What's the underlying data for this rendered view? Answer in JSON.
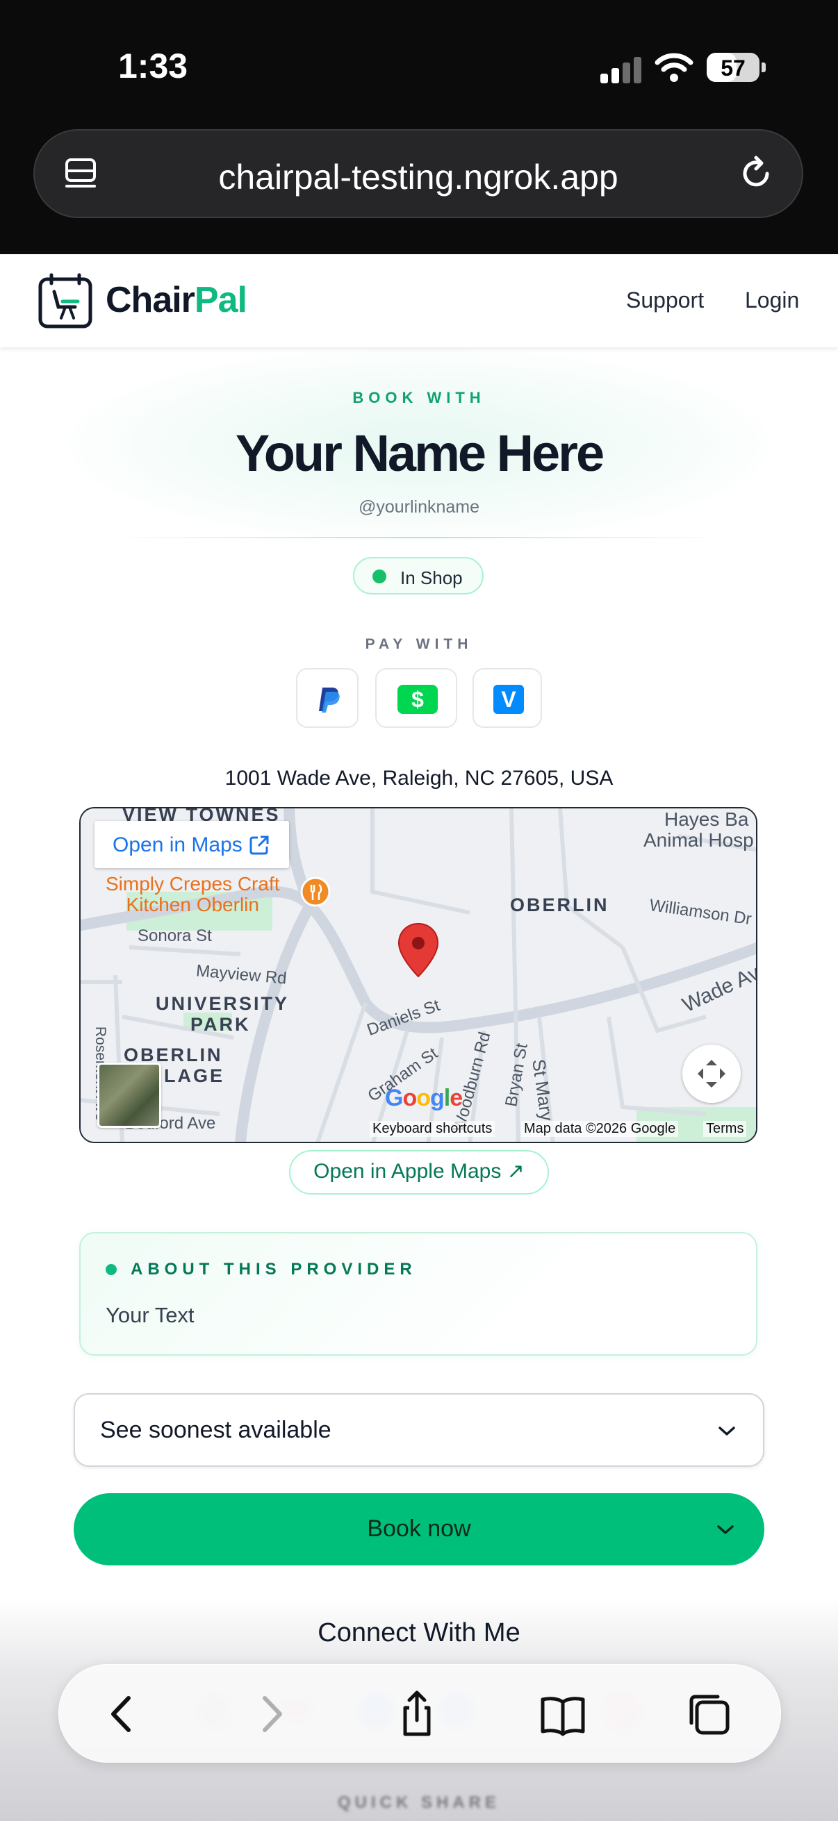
{
  "status_bar": {
    "time": "1:33",
    "battery": "57"
  },
  "browser": {
    "url": "chairpal-testing.ngrok.app"
  },
  "header": {
    "brand_part1": "Chair",
    "brand_part2": "Pal",
    "nav": [
      "Support",
      "Login"
    ]
  },
  "hero": {
    "kicker": "BOOK WITH",
    "name": "Your Name Here",
    "handle": "@yourlinkname",
    "status": "In Shop",
    "pay_label": "PAY WITH",
    "pay_methods": [
      {
        "name": "PayPal",
        "glyph": "P",
        "color": "#1e5bd6"
      },
      {
        "name": "Cash App",
        "glyph": "$",
        "color": "#00d64f"
      },
      {
        "name": "Venmo",
        "glyph": "V",
        "color": "#008cff"
      }
    ]
  },
  "location": {
    "address": "1001 Wade Ave, Raleigh, NC 27605, USA",
    "open_in_maps": "Open in Maps",
    "poi": "Simply Crepes Craft Kitchen Oberlin",
    "labels": {
      "view_townes": "VIEW TOWNES",
      "hayes": "Hayes Ba",
      "animal": "Animal Hosp",
      "oberlin": "OBERLIN",
      "williamson": "Williamson Dr",
      "wade": "Wade Ave",
      "sonora": "Sonora St",
      "mayview": "Mayview Rd",
      "university": "UNIVERSITY",
      "park": "PARK",
      "daniels": "Daniels St",
      "oberlin_village_1": "OBERLIN",
      "oberlin_village_2": "LAGE",
      "graham": "Graham St",
      "woodburn": "Woodburn Rd",
      "bryan": "Bryan St",
      "stmary": "St Mary",
      "rosemont": "Rosemont Ave",
      "bedford": "Bedford Ave"
    },
    "google": "Google",
    "keyboard_shortcuts": "Keyboard shortcuts",
    "map_data": "Map data ©2026 Google",
    "terms": "Terms",
    "apple_maps": "Open in Apple Maps ↗"
  },
  "about": {
    "title": "ABOUT THIS PROVIDER",
    "body": "Your Text"
  },
  "booking": {
    "availability_select": "See soonest available",
    "book_now": "Book now"
  },
  "connect": {
    "title": "Connect With Me",
    "quick_share": "QUICK SHARE"
  },
  "colors": {
    "accent": "#10b981",
    "button": "#00bf7a",
    "map_pin": "#e53935"
  }
}
